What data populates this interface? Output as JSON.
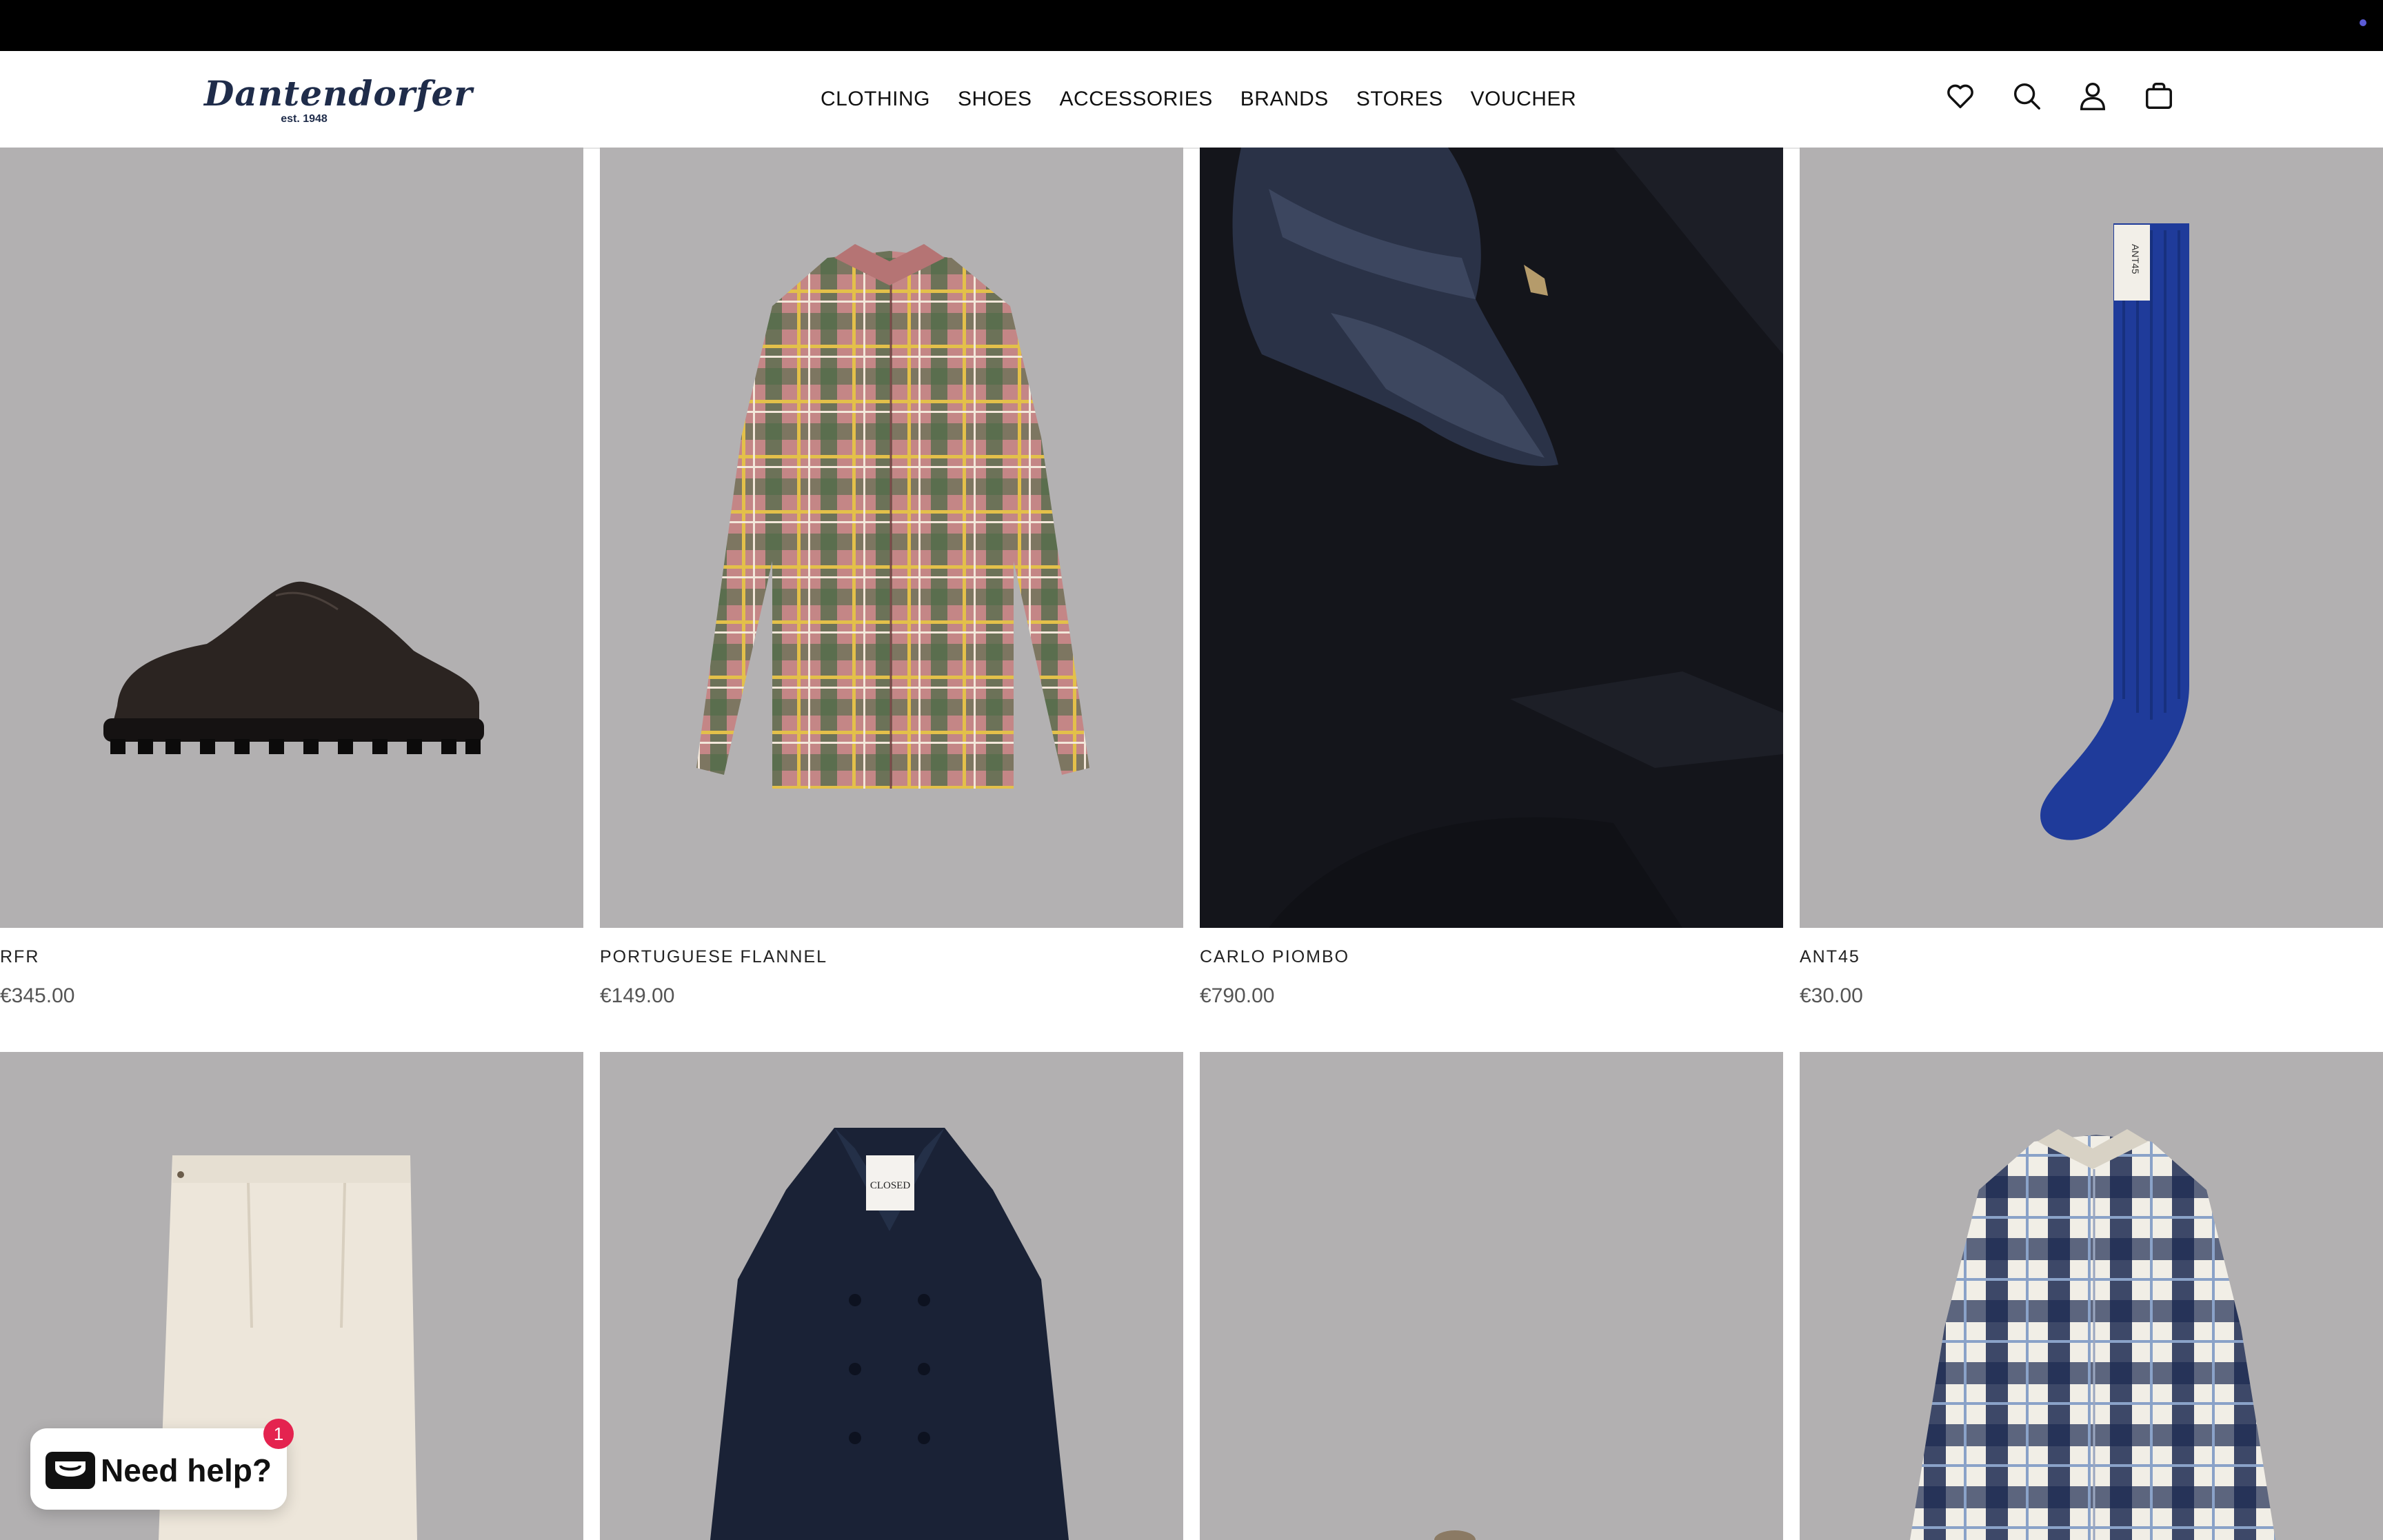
{
  "header": {
    "logo_text": "Dantendorfer",
    "logo_est": "est. 1948",
    "nav": [
      {
        "label": "CLOTHING"
      },
      {
        "label": "SHOES"
      },
      {
        "label": "ACCESSORIES"
      },
      {
        "label": "BRANDS"
      },
      {
        "label": "STORES"
      },
      {
        "label": "VOUCHER"
      }
    ],
    "icons": [
      "heart-icon",
      "search-icon",
      "account-icon",
      "bag-icon"
    ]
  },
  "products": [
    {
      "brand": "RFR",
      "price": "€345.00"
    },
    {
      "brand": "PORTUGUESE FLANNEL",
      "price": "€149.00"
    },
    {
      "brand": "CARLO PIOMBO",
      "price": "€790.00"
    },
    {
      "brand": "ANT45",
      "price": "€30.00"
    }
  ],
  "product_image_text": {
    "sock_tag": "ANT45",
    "coat_label": "CLOSED"
  },
  "help_widget": {
    "label": "Need help?",
    "badge": "1"
  },
  "colors": {
    "image_bg": "#b0aeaf",
    "badge": "#e4234f",
    "topbar": "#000000"
  }
}
